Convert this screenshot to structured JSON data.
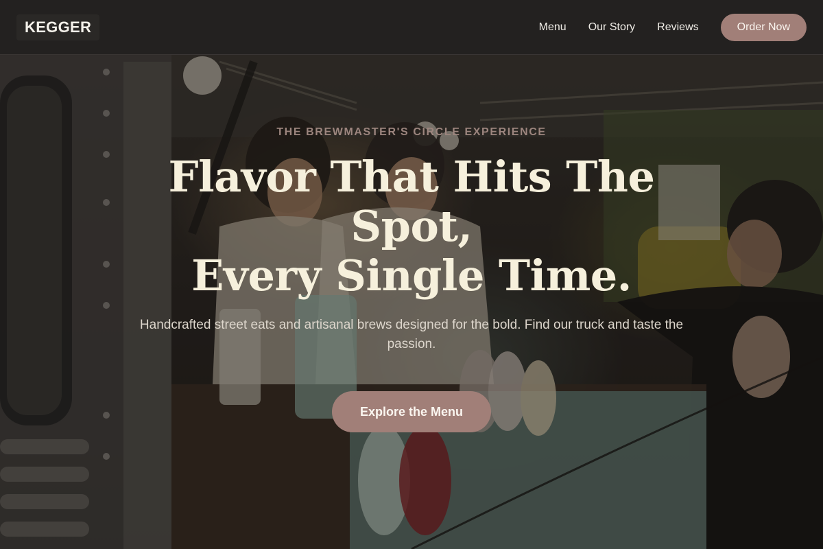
{
  "nav": {
    "brand": "KEGGER",
    "links": [
      "Menu",
      "Our Story",
      "Reviews"
    ],
    "order_label": "Order Now"
  },
  "hero": {
    "eyebrow": "THE BREWMASTER'S CIRCLE EXPERIENCE",
    "headline_line1": "Flavor That Hits The Spot,",
    "headline_line2": "Every Single Time.",
    "subtext": "Handcrafted street eats and artisanal brews designed for the bold. Find our truck and taste the passion.",
    "cta_label": "Explore the Menu"
  },
  "colors": {
    "nav_bg": "#232120",
    "accent": "#a17f78",
    "headline": "#f6f0dc",
    "eyebrow": "#9c857e"
  }
}
